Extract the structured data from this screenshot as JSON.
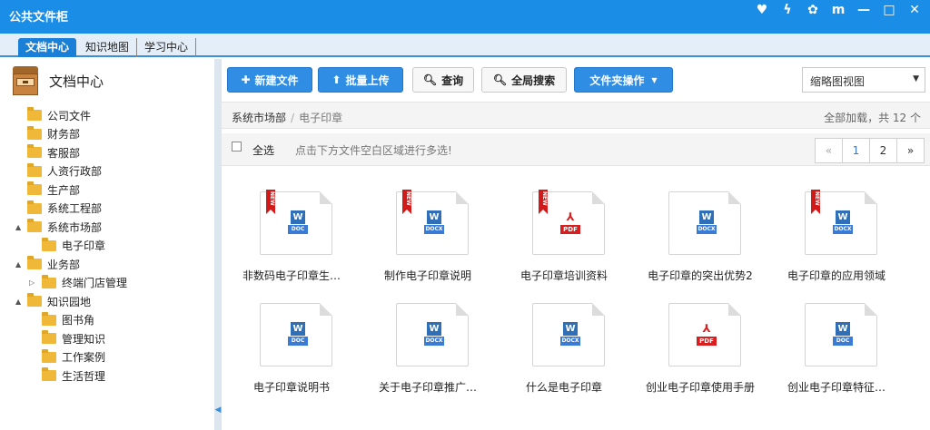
{
  "app": {
    "title": "公共文件柜"
  },
  "window_controls": [
    {
      "name": "heart-icon",
      "glyph": "♥"
    },
    {
      "name": "lightning-icon",
      "glyph": "ϟ"
    },
    {
      "name": "gear-icon",
      "glyph": "✿"
    },
    {
      "name": "book-icon",
      "glyph": "m"
    },
    {
      "name": "minimize-icon",
      "glyph": "—"
    },
    {
      "name": "maximize-icon",
      "glyph": "□"
    },
    {
      "name": "close-icon",
      "glyph": "✕"
    }
  ],
  "tabs": [
    {
      "label": "文档中心",
      "active": true
    },
    {
      "label": "知识地图",
      "active": false
    },
    {
      "label": "学习中心",
      "active": false
    }
  ],
  "sidebar": {
    "title": "文档中心",
    "tree": [
      {
        "label": "公司文件",
        "level": 0,
        "arrow": ""
      },
      {
        "label": "财务部",
        "level": 0,
        "arrow": ""
      },
      {
        "label": "客服部",
        "level": 0,
        "arrow": ""
      },
      {
        "label": "人资行政部",
        "level": 0,
        "arrow": ""
      },
      {
        "label": "生产部",
        "level": 0,
        "arrow": ""
      },
      {
        "label": "系统工程部",
        "level": 0,
        "arrow": ""
      },
      {
        "label": "系统市场部",
        "level": 0,
        "arrow": "▲"
      },
      {
        "label": "电子印章",
        "level": 1,
        "arrow": ""
      },
      {
        "label": "业务部",
        "level": 0,
        "arrow": "▲"
      },
      {
        "label": "终端门店管理",
        "level": 1,
        "arrow": "▷"
      },
      {
        "label": "知识园地",
        "level": 0,
        "arrow": "▲"
      },
      {
        "label": "图书角",
        "level": 1,
        "arrow": ""
      },
      {
        "label": "管理知识",
        "level": 1,
        "arrow": ""
      },
      {
        "label": "工作案例",
        "level": 1,
        "arrow": ""
      },
      {
        "label": "生活哲理",
        "level": 1,
        "arrow": ""
      }
    ]
  },
  "toolbar": {
    "new_file": "新建文件",
    "batch_upload": "批量上传",
    "query": "查询",
    "global_search": "全局搜索",
    "folder_ops": "文件夹操作",
    "view_mode": "缩略图视图"
  },
  "path": {
    "root": "系统市场部",
    "separator": "/",
    "current": "电子印章",
    "load_info": "全部加载，共 12 个"
  },
  "selection": {
    "label": "全选",
    "hint": "点击下方文件空白区域进行多选!"
  },
  "pager": {
    "prev": "«",
    "pages": [
      "1",
      "2"
    ],
    "current": "1",
    "next": "»"
  },
  "files": [
    {
      "name": "非数码电子印章生…",
      "type": "DOC",
      "new": true
    },
    {
      "name": "制作电子印章说明",
      "type": "DOCX",
      "new": true
    },
    {
      "name": "电子印章培训资料",
      "type": "PDF",
      "new": true
    },
    {
      "name": "电子印章的突出优势2",
      "type": "DOCX",
      "new": false
    },
    {
      "name": "电子印章的应用领域",
      "type": "DOCX",
      "new": true
    },
    {
      "name": "电子印章说明书",
      "type": "DOC",
      "new": false
    },
    {
      "name": "关于电子印章推广…",
      "type": "DOCX",
      "new": false
    },
    {
      "name": "什么是电子印章",
      "type": "DOCX",
      "new": false
    },
    {
      "name": "创业电子印章使用手册",
      "type": "PDF",
      "new": false
    },
    {
      "name": "创业电子印章特征…",
      "type": "DOC",
      "new": false
    }
  ],
  "badge_text": "NEW",
  "word_letter": "W",
  "pdf_glyph": "⅄"
}
